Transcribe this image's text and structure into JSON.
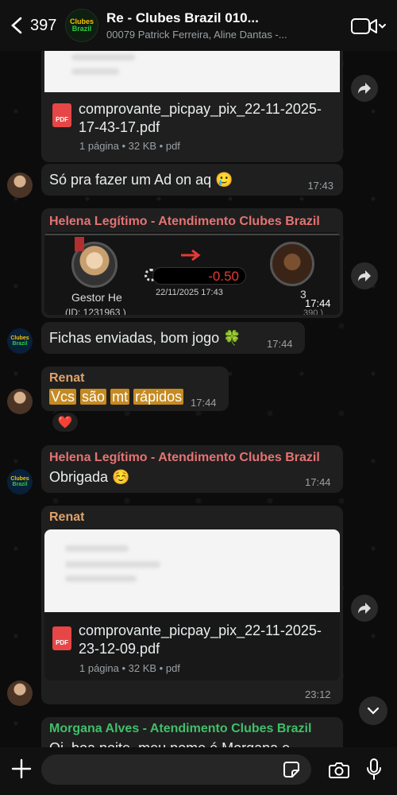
{
  "header": {
    "back_count": "397",
    "group_title": "Re                       - Clubes Brazil 010...",
    "participants": "00079 Patrick Ferreira, Aline Dantas -..."
  },
  "group_avatar": {
    "line1": "Clubes",
    "line2": "Brazil"
  },
  "messages": {
    "doc1": {
      "filename": "comprovante_picpay_pix_22-11-2025-17-43-17.pdf",
      "meta": "1 página • 32 KB • pdf",
      "pdf_label": "PDF"
    },
    "m1": {
      "text": "Só pra fazer um Ad on aq 🥲",
      "time": "17:43"
    },
    "m2": {
      "sender": "Helena Legítimo - Atendimento Clubes Brazil",
      "left_name": "Gestor He",
      "left_id": "(ID: 1231963 )",
      "amount": "-0.50",
      "datetime": "22/11/2025 17:43",
      "right_partial": "3",
      "right_id_partial": "390 )",
      "time": "17:44"
    },
    "m3": {
      "text": "Fichas enviadas, bom jogo 🍀",
      "time": "17:44"
    },
    "m4": {
      "sender": "Renat",
      "text_words": [
        "Vcs",
        "são",
        "mt",
        "rápidos"
      ],
      "time": "17:44",
      "reaction": "❤️"
    },
    "m5": {
      "sender": "Helena Legítimo - Atendimento Clubes Brazil",
      "text": "Obrigada ☺️",
      "time": "17:44"
    },
    "m6": {
      "sender": "Renat",
      "filename": "comprovante_picpay_pix_22-11-2025-23-12-09.pdf",
      "meta": "1 página • 32 KB • pdf",
      "pdf_label": "PDF",
      "time": "23:12"
    },
    "m7": {
      "sender": "Morgana Alves - Atendimento Clubes Brazil",
      "text": "Oi, boa noite, meu nome é Morgana e"
    }
  },
  "colors": {
    "helena": "#e57373",
    "renata": "#e0a36b",
    "morgana": "#3fc06a",
    "accent_red": "#e53935"
  },
  "icons": [
    "back-chevron-icon",
    "video-call-icon",
    "forward-icon",
    "pdf-icon",
    "plus-icon",
    "sticker-icon",
    "camera-icon",
    "mic-icon",
    "scroll-down-icon"
  ]
}
